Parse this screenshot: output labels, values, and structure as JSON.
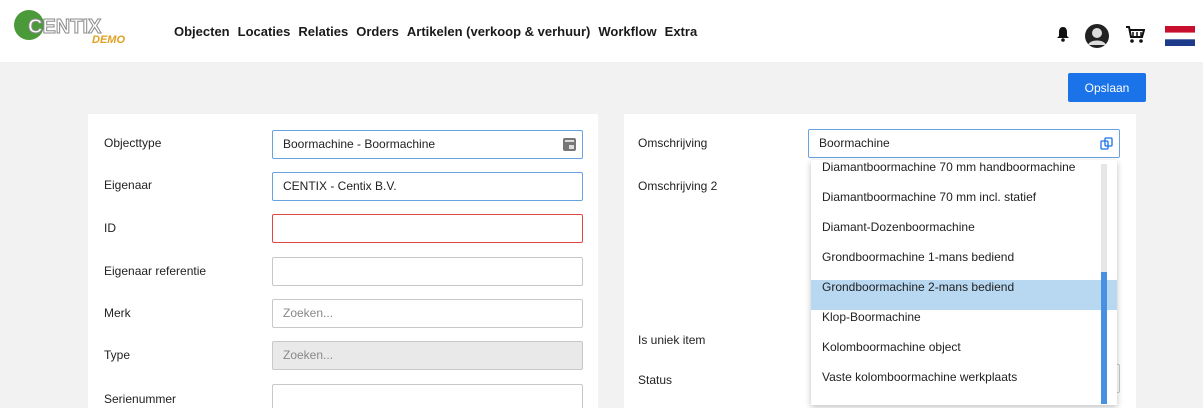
{
  "logo": {
    "brand": "CENTIX",
    "sub": "DEMO"
  },
  "nav": [
    "Objecten",
    "Locaties",
    "Relaties",
    "Orders",
    "Artikelen (verkoop & verhuur)",
    "Workflow",
    "Extra"
  ],
  "top_icons": [
    "bell-icon",
    "avatar-icon",
    "cart-icon",
    "flag-nl-icon"
  ],
  "save_label": "Opslaan",
  "left": {
    "objecttype": {
      "label": "Objecttype",
      "value": "Boormachine - Boormachine"
    },
    "eigenaar": {
      "label": "Eigenaar",
      "value": "CENTIX - Centix B.V."
    },
    "id": {
      "label": "ID",
      "value": ""
    },
    "eigenaar_ref": {
      "label": "Eigenaar referentie",
      "value": ""
    },
    "merk": {
      "label": "Merk",
      "placeholder": "Zoeken..."
    },
    "type": {
      "label": "Type",
      "placeholder": "Zoeken..."
    },
    "serienummer": {
      "label": "Serienummer",
      "value": ""
    }
  },
  "right": {
    "omschrijving": {
      "label": "Omschrijving",
      "value": "Boormachine"
    },
    "omschrijving2": {
      "label": "Omschrijving 2"
    },
    "is_uniek": {
      "label": "Is uniek item"
    },
    "status": {
      "label": "Status"
    }
  },
  "dropdown": {
    "items": [
      "Diamantboormachine 70 mm handboormachine",
      "Diamantboormachine 70 mm incl. statief",
      "Diamant-Dozenboormachine",
      "Grondboormachine 1-mans bediend",
      "Grondboormachine 2-mans bediend",
      "Klop-Boormachine",
      "Kolomboormachine object",
      "Vaste kolomboormachine werkplaats"
    ],
    "selected": "Grondboormachine 2-mans bediend"
  },
  "colors": {
    "accent": "#1a73e8",
    "error": "#e04848",
    "selected": "#b8d8f2"
  }
}
